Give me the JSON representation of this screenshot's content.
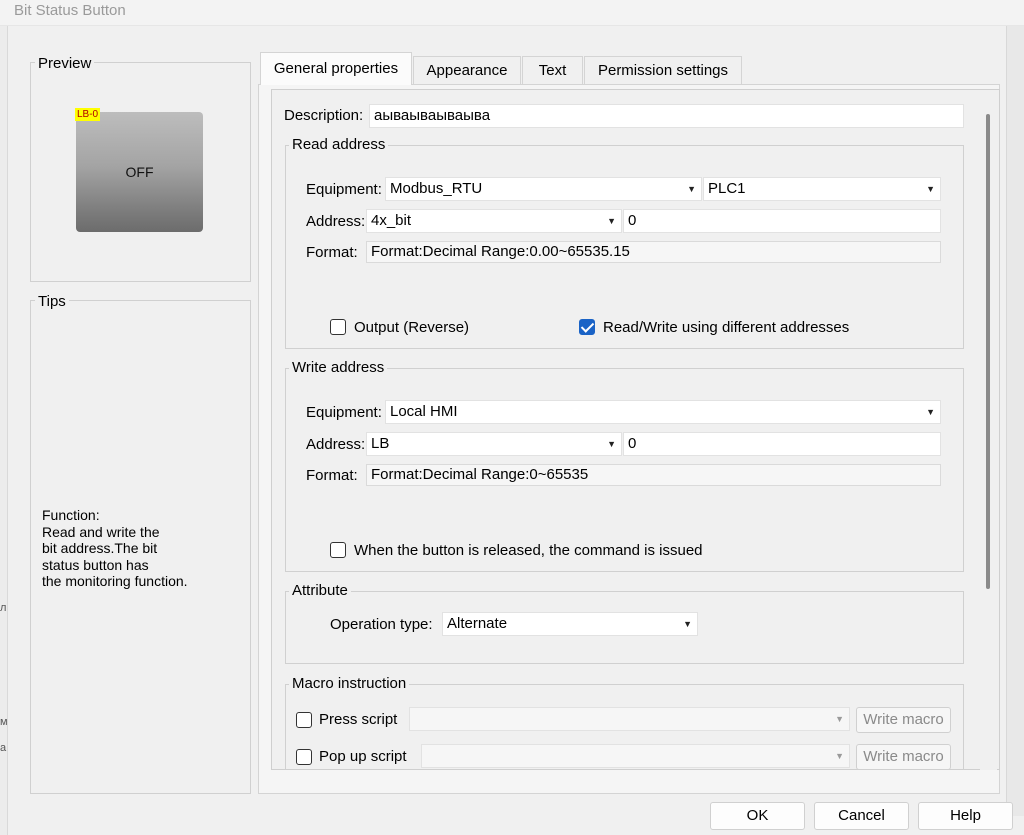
{
  "window": {
    "title": "Bit Status Button"
  },
  "left_strip": {
    "glyphs": [
      "л",
      "м",
      "а"
    ]
  },
  "preview": {
    "title": "Preview",
    "tag": "LB-0",
    "state_label": "OFF"
  },
  "tips": {
    "title": "Tips",
    "lines": [
      "Function:",
      "Read and write the",
      "bit address.The bit",
      "status button has",
      "the monitoring function."
    ]
  },
  "tabs": [
    {
      "label": "General properties",
      "active": true
    },
    {
      "label": "Appearance",
      "active": false
    },
    {
      "label": "Text",
      "active": false
    },
    {
      "label": "Permission settings",
      "active": false
    }
  ],
  "general": {
    "description": {
      "label": "Description:",
      "value": "аываываываыва"
    },
    "read_address": {
      "title": "Read address",
      "equipment_label": "Equipment:",
      "equipment_value": "Modbus_RTU",
      "plc_value": "PLC1",
      "address_label": "Address:",
      "address_type": "4x_bit",
      "address_value": "0",
      "format_label": "Format:",
      "format_value": "Format:Decimal  Range:0.00~65535.15",
      "output_reverse": {
        "label": "Output (Reverse)",
        "checked": false
      },
      "rw_different": {
        "label": "Read/Write using different addresses",
        "checked": true
      }
    },
    "write_address": {
      "title": "Write address",
      "equipment_label": "Equipment:",
      "equipment_value": "Local HMI",
      "address_label": "Address:",
      "address_type": "LB",
      "address_value": "0",
      "format_label": "Format:",
      "format_value": "Format:Decimal  Range:0~65535",
      "on_release": {
        "label": "When the button is released, the command is issued",
        "checked": false
      }
    },
    "attribute": {
      "title": "Attribute",
      "operation_label": "Operation type:",
      "operation_value": "Alternate"
    },
    "macro": {
      "title": "Macro instruction",
      "press_script": {
        "label": "Press script",
        "checked": false,
        "button": "Write macro"
      },
      "popup_script": {
        "label": "Pop up script",
        "checked": false,
        "button": "Write macro"
      }
    }
  },
  "footer": {
    "ok": "OK",
    "cancel": "Cancel",
    "help": "Help"
  },
  "colors": {
    "accent": "#1a63c6",
    "tag_bg": "#ffff00",
    "window_bg": "#f0f0f0"
  }
}
